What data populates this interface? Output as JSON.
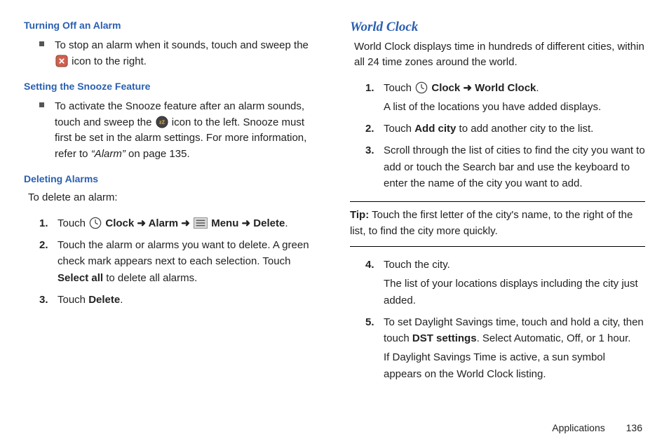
{
  "left": {
    "h_turn": "Turning Off an Alarm",
    "bullet_turn_a": "To stop an alarm when it sounds, touch and sweep the",
    "bullet_turn_b": " icon to the right.",
    "h_snooze": "Setting the Snooze Feature",
    "bullet_snooze_a": "To activate the Snooze feature after an alarm sounds, touch and sweep the ",
    "bullet_snooze_b": " icon to the left. Snooze must first be set in the alarm settings. For more information, refer to ",
    "bullet_snooze_ref": "“Alarm”",
    "bullet_snooze_c": "  on page 135.",
    "h_delete": "Deleting Alarms",
    "delete_intro": "To delete an alarm:",
    "del1_a": "Touch ",
    "clock_lbl": "Clock",
    "arrow": " ➜ ",
    "alarm_lbl": "Alarm",
    "menu_lbl": "Menu",
    "delete_lbl": "Delete",
    "del2_a": "Touch the alarm or alarms you want to delete. A green check mark appears next to each selection. Touch ",
    "select_all": "Select all",
    "del2_b": " to delete all alarms.",
    "del3_a": "Touch ",
    "period": "."
  },
  "right": {
    "h_world": "World Clock",
    "intro": "World Clock displays time in hundreds of different cities, within all 24 time zones around the world.",
    "s1_a": "Touch ",
    "clock_lbl": "Clock",
    "arrow": " ➜ ",
    "world_lbl": "World Clock",
    "s1_b": ".",
    "s1_sub": "A list of the locations you have added displays.",
    "s2_a": "Touch ",
    "addcity": "Add city",
    "s2_b": " to add another city to the list.",
    "s3": "Scroll through the list of cities to find the city you want to add or touch the Search bar and use the keyboard to enter the name of the city you want to add.",
    "tip_lbl": "Tip:",
    "tip_txt": " Touch the first letter of the city's name, to the right of the list, to find the city more quickly.",
    "s4_a": "Touch the city.",
    "s4_sub": "The list of your locations displays including the city just added.",
    "s5_a": "To set Daylight Savings time, touch and hold a city, then touch ",
    "dst": "DST settings",
    "s5_b": ". Select Automatic, Off, or 1 hour.",
    "s5_sub": "If Daylight Savings Time is active, a sun symbol appears on the World Clock listing."
  },
  "footer": {
    "section": "Applications",
    "page": "136"
  }
}
